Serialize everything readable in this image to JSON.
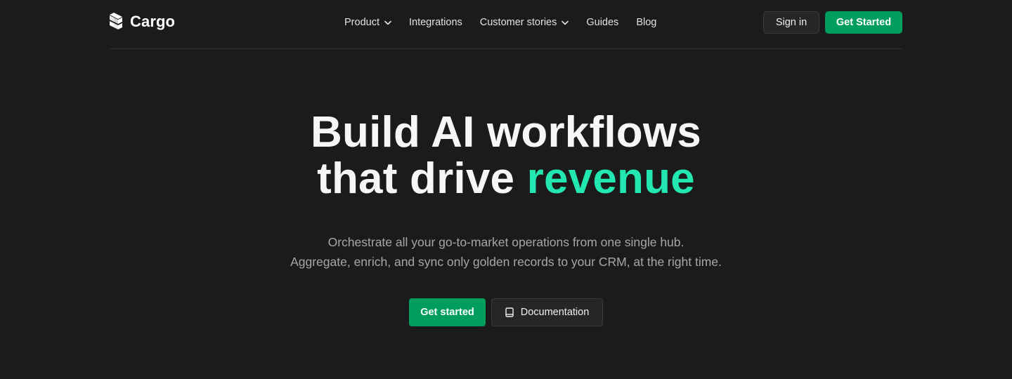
{
  "brand": {
    "name": "Cargo",
    "logo_icon": "cargo-logo-mark"
  },
  "nav": {
    "items": [
      {
        "label": "Product",
        "has_dropdown": true,
        "icon": "chevron-down-icon"
      },
      {
        "label": "Integrations",
        "has_dropdown": false
      },
      {
        "label": "Customer stories",
        "has_dropdown": true,
        "icon": "chevron-down-icon"
      },
      {
        "label": "Guides",
        "has_dropdown": false
      },
      {
        "label": "Blog",
        "has_dropdown": false
      }
    ],
    "sign_in_label": "Sign in",
    "get_started_label": "Get Started"
  },
  "hero": {
    "title_line1": "Build AI workflows",
    "title_line2_prefix": "that drive ",
    "title_line2_accent": "revenue",
    "subtitle_line1": "Orchestrate all your go-to-market operations from one single hub.",
    "subtitle_line2": "Aggregate, enrich, and sync only golden records to your CRM, at the right time.",
    "cta_primary_label": "Get started",
    "cta_secondary_label": "Documentation",
    "cta_secondary_icon": "book-icon"
  },
  "colors": {
    "background": "#1b1b1b",
    "accent_text": "#22e7b0",
    "primary_button": "#009e5e",
    "secondary_button": "#262626"
  }
}
